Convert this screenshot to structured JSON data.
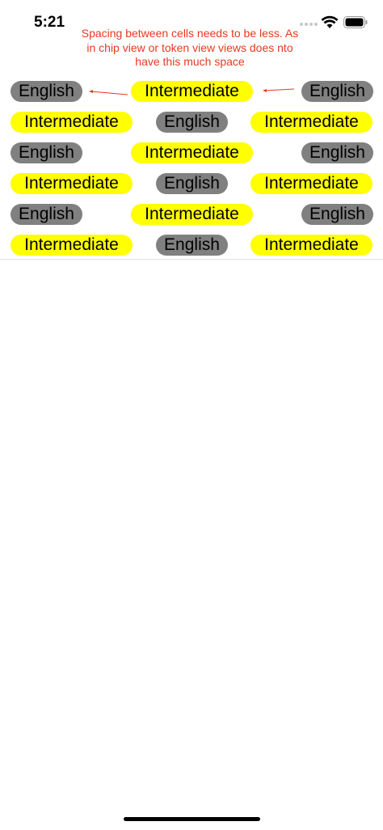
{
  "status_bar": {
    "time": "5:21"
  },
  "annotation": {
    "text": "Spacing between cells needs to be less. As in chip view or token view views does nto have this much space",
    "color": "#e33b1e"
  },
  "colors": {
    "gray_chip": "#808080",
    "yellow_chip": "#ffff00"
  },
  "rows": [
    {
      "chips": [
        "English",
        "Intermediate",
        "English"
      ]
    },
    {
      "chips": [
        "Intermediate",
        "English",
        "Intermediate"
      ]
    },
    {
      "chips": [
        "English",
        "Intermediate",
        "English"
      ]
    },
    {
      "chips": [
        "Intermediate",
        "English",
        "Intermediate"
      ]
    },
    {
      "chips": [
        "English",
        "Intermediate",
        "English"
      ]
    },
    {
      "chips": [
        "Intermediate",
        "English",
        "Intermediate"
      ]
    }
  ]
}
